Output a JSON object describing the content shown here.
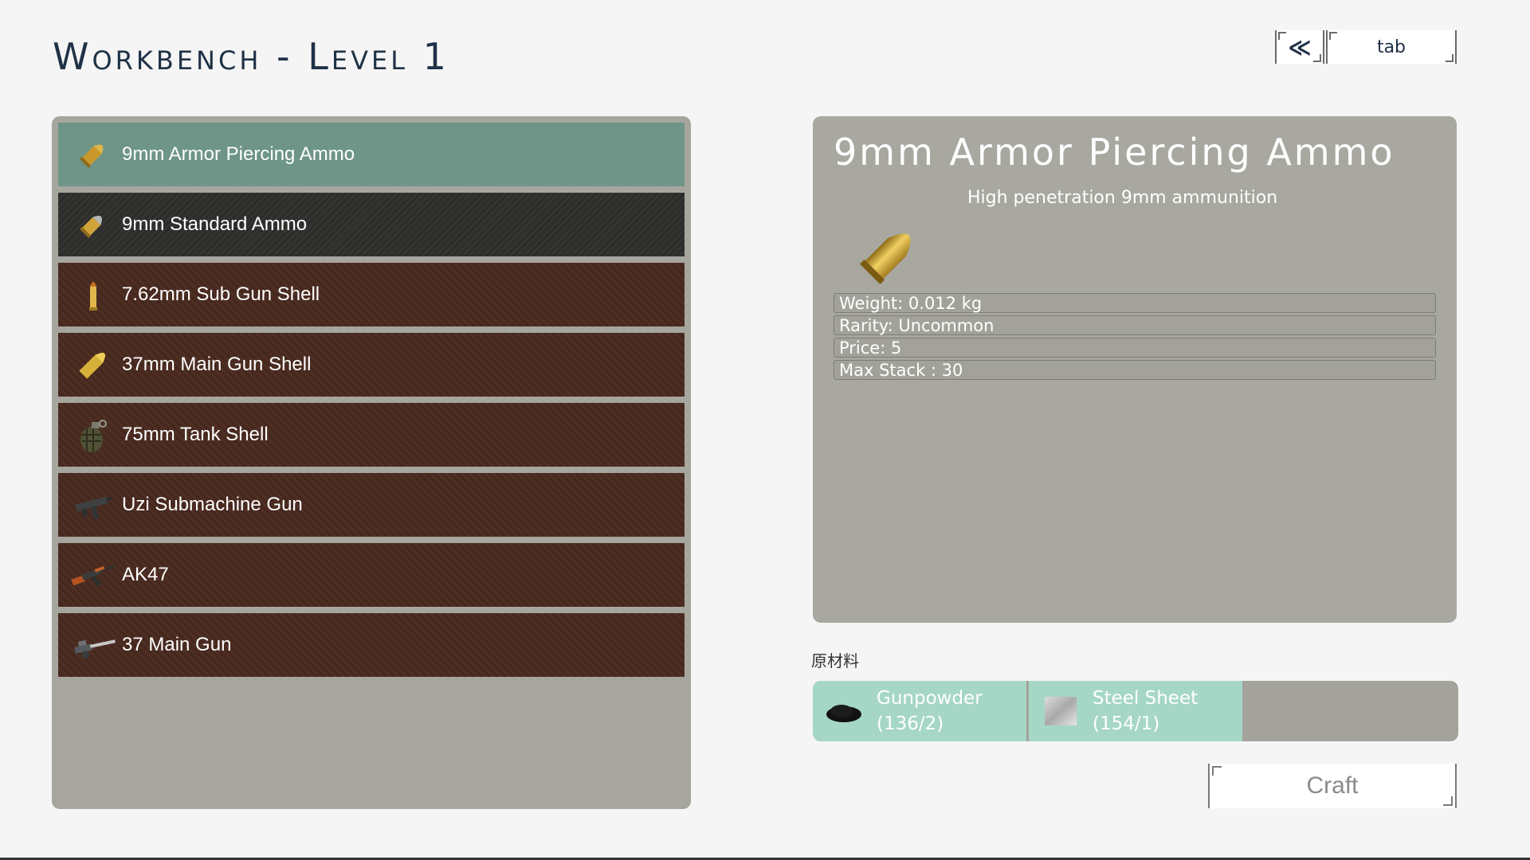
{
  "title": "Workbench - Level 1",
  "nav": {
    "back_icon": "double-chevron-left-icon",
    "back_label": "≪",
    "tab_label": "tab"
  },
  "items": [
    {
      "label": "9mm Armor Piercing Ammo",
      "icon": "bullet-icon",
      "state": "selected"
    },
    {
      "label": "9mm Standard Ammo",
      "icon": "bullet-icon",
      "state": "dark"
    },
    {
      "label": "7.62mm Sub Gun Shell",
      "icon": "cartridge-icon",
      "state": "normal"
    },
    {
      "label": "37mm Main Gun Shell",
      "icon": "shell-icon",
      "state": "normal"
    },
    {
      "label": "75mm Tank Shell",
      "icon": "grenade-icon",
      "state": "normal"
    },
    {
      "label": "Uzi Submachine Gun",
      "icon": "uzi-icon",
      "state": "normal"
    },
    {
      "label": "AK47",
      "icon": "rifle-icon",
      "state": "normal"
    },
    {
      "label": "37 Main Gun",
      "icon": "cannon-icon",
      "state": "normal"
    }
  ],
  "detail": {
    "name": "9mm Armor Piercing Ammo",
    "description": "High penetration 9mm ammunition",
    "image_icon": "bullet-icon",
    "stats": [
      "Weight:  0.012 kg",
      "Rarity:  Uncommon",
      "Price:  5",
      "Max Stack : 30"
    ]
  },
  "materials": {
    "label": "原材料",
    "items": [
      {
        "name": "Gunpowder",
        "count": "(136/2)",
        "icon": "gunpowder-icon"
      },
      {
        "name": "Steel Sheet",
        "count": "(154/1)",
        "icon": "steel-sheet-icon"
      }
    ]
  },
  "craft_label": "Craft",
  "colors": {
    "title": "#1f3146",
    "selected_row": "#6e9587",
    "row": "#4a2a1f",
    "panel": "#a8a8a0",
    "material": "#a6d7c6"
  }
}
